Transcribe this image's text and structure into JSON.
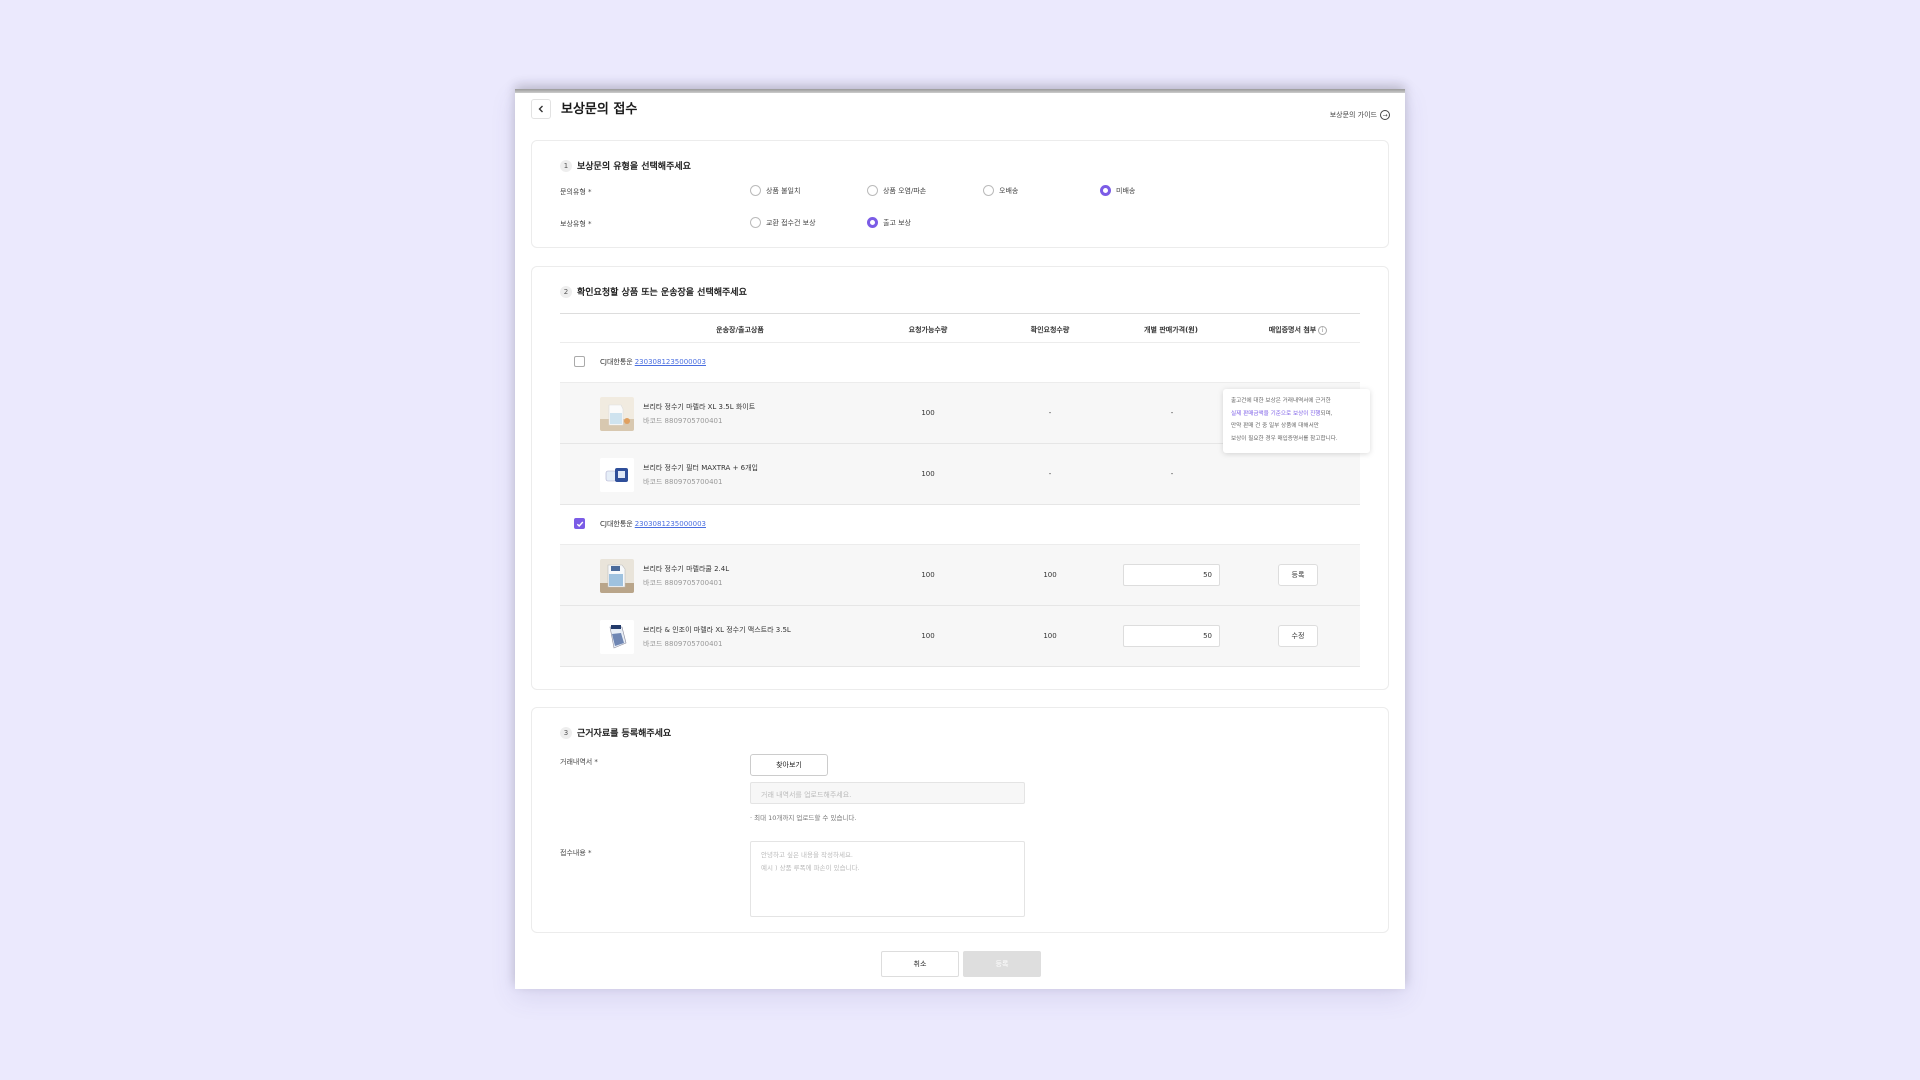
{
  "header": {
    "title": "보상문의 접수",
    "guide_label": "보상문의 가이드"
  },
  "section1": {
    "number": "1",
    "title": "보상문의 유형을 선택해주세요",
    "inquiry_type": {
      "label": "문의유형 *",
      "options": [
        "상품 불일치",
        "상품 오염/파손",
        "오배송",
        "미배송"
      ],
      "selected": "미배송"
    },
    "compensation_type": {
      "label": "보상유형 *",
      "options": [
        "교환 접수건 보상",
        "출고 보상"
      ],
      "selected": "출고 보상"
    }
  },
  "section2": {
    "number": "2",
    "title": "확인요청할 상품 또는 운송장을 선택해주세요",
    "columns": [
      "운송장/출고상품",
      "요청가능수량",
      "확인요청수량",
      "개별 판매가격(원)",
      "매입증명서 첨부"
    ],
    "tooltip": {
      "line1": "출고건에 대한 보상은 거래내역서에 근거한",
      "line2_highlight": "실제 판매금액을 기준으로 보상이 진행",
      "line2_rest": "되며,",
      "line3": "만약 판매 건 중 일부 상품에 대해서만",
      "line4": "보상이 필요한 경우 매입증명서를 참고합니다."
    },
    "groups": [
      {
        "carrier": "CJ대한통운",
        "tracking": "2303081235000003",
        "checked": false,
        "items": [
          {
            "name": "브리타 정수기 마렐라 XL 3.5L 화이트",
            "barcode": "바코드 8809705700401",
            "available": "100",
            "requested": "-",
            "price": "-",
            "action": ""
          },
          {
            "name": "브리타 정수기 필터 MAXTRA + 6개입",
            "barcode": "바코드 8809705700401",
            "available": "100",
            "requested": "-",
            "price": "-",
            "action": ""
          }
        ]
      },
      {
        "carrier": "CJ대한통운",
        "tracking": "2303081235000003",
        "checked": true,
        "items": [
          {
            "name": "브리타 정수기 마렐라쿨 2.4L",
            "barcode": "바코드 8809705700401",
            "available": "100",
            "requested": "100",
            "price": "50",
            "action": "등록"
          },
          {
            "name": "브리타 & 인조이 마렐라 XL 정수기 맥스트라 3.5L",
            "barcode": "바코드 8809705700401",
            "available": "100",
            "requested": "100",
            "price": "50",
            "action": "수정"
          }
        ]
      }
    ]
  },
  "section3": {
    "number": "3",
    "title": "근거자료를 등록해주세요",
    "statement_label": "거래내역서 *",
    "find_button": "찾아보기",
    "file_placeholder": "거래 내역서를 업로드해주세요.",
    "hint": "· 최대 10개까지 업로드할 수 있습니다.",
    "content_label": "접수내용 *",
    "content_placeholder": "안녕하고 싶은 내용을 작성하세요.\n예시 ) 상품 루폭에 파손이 있습니다."
  },
  "footer": {
    "cancel": "취소",
    "submit": "등록"
  },
  "colors": {
    "accent": "#7b5ce6",
    "link": "#4a6ee0",
    "background": "#ebe9fd"
  }
}
